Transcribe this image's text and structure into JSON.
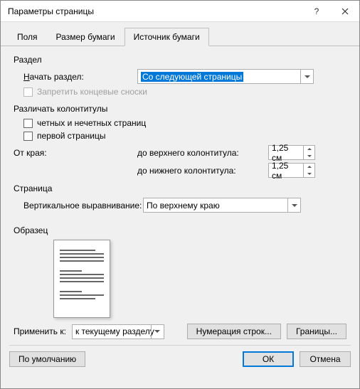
{
  "window": {
    "title": "Параметры страницы"
  },
  "tabs": {
    "fields": "Поля",
    "paper_size": "Размер бумаги",
    "paper_source": "Источник бумаги"
  },
  "section": {
    "group": "Раздел",
    "start_prefix": "Н",
    "start_rest": "ачать раздел:",
    "start_value": "Со следующей страницы",
    "suppress_prefix": "З",
    "suppress_rest": "апретить концевые сноски"
  },
  "headers": {
    "group": "Различать колонтитулы",
    "odd_even_prefix": "ч",
    "odd_even_rest": "етных и нечетных страниц",
    "first_prefix": "п",
    "first_rest": "ервой страницы",
    "from_edge": "От края:",
    "to_header_pre": "до вер",
    "to_header_ul": "х",
    "to_header_post": "него колонтитула:",
    "to_footer_pre": "до ни",
    "to_footer_ul": "ж",
    "to_footer_post": "него колонтитула:",
    "header_val": "1,25 см",
    "footer_val": "1,25 см"
  },
  "page": {
    "group": "Страница",
    "valign_pre": "В",
    "valign_rest": "ертикальное выравнивание:",
    "valign_value": "По верхнему краю"
  },
  "preview": {
    "group": "Образец"
  },
  "apply": {
    "label_pre": "Применить ",
    "label_ul": "к",
    "label_post": ":",
    "value": "к текущему разделу",
    "line_numbers": "Нумерация строк...",
    "borders_pre": "Грани",
    "borders_ul": "ц",
    "borders_post": "ы..."
  },
  "buttons": {
    "default_pre": "По у",
    "default_ul": "м",
    "default_post": "олчанию",
    "ok": "ОК",
    "cancel": "Отмена"
  }
}
